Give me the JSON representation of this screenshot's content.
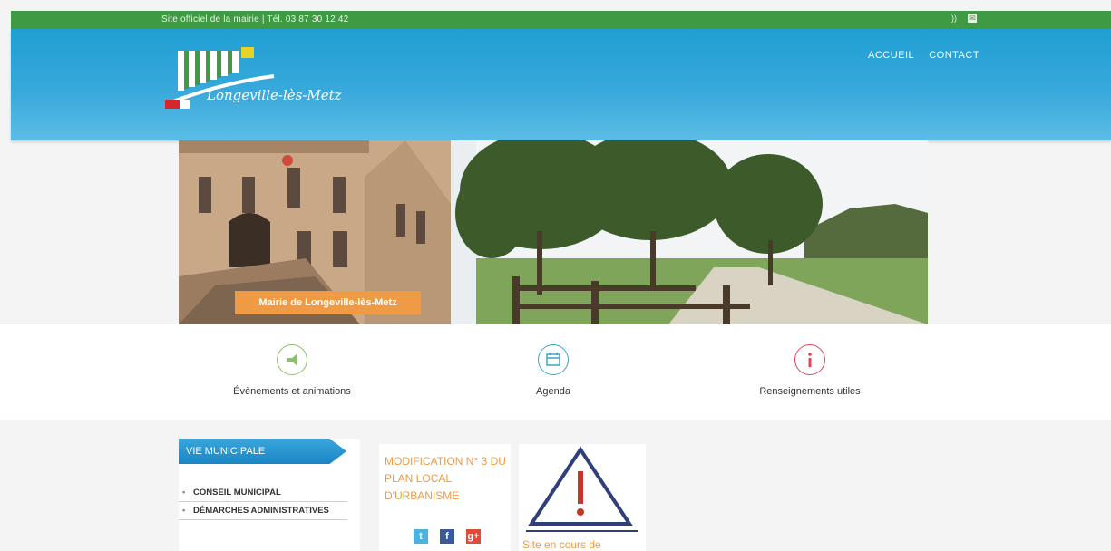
{
  "topbar": {
    "tagline": "Site officiel de la mairie | Tél. 03 87 30 12 42",
    "icons": [
      "rss-icon",
      "mail-icon"
    ]
  },
  "header": {
    "logo_text": "Longeville-lès-Metz",
    "nav": [
      {
        "label": "ACCUEIL"
      },
      {
        "label": "CONTACT"
      }
    ]
  },
  "banner": {
    "caption": "Mairie de Longeville-lès-Metz"
  },
  "quicklinks": [
    {
      "label": "Évènements et animations",
      "icon": "megaphone-icon",
      "color": "#8cc06a"
    },
    {
      "label": "Agenda",
      "icon": "calendar-icon",
      "color": "#3aa8c8"
    },
    {
      "label": "Renseignements utiles",
      "icon": "info-icon",
      "color": "#e0455a"
    }
  ],
  "sidebar": {
    "heading": "VIE MUNICIPALE",
    "items": [
      {
        "label": "CONSEIL MUNICIPAL"
      },
      {
        "label": "DÉMARCHES ADMINISTRATIVES"
      }
    ]
  },
  "news": [
    {
      "title": "MODIFICATION N° 3 DU PLAN LOCAL D'URBANISME"
    },
    {
      "title": "Site en cours de"
    }
  ],
  "social": [
    {
      "name": "twitter-icon",
      "glyph": "t",
      "color": "#4ab3e0"
    },
    {
      "name": "facebook-icon",
      "glyph": "f",
      "color": "#3b5a9a"
    },
    {
      "name": "googleplus-icon",
      "glyph": "g+",
      "color": "#dd4b39"
    }
  ],
  "colors": {
    "topbar": "#3e9a43",
    "header": "#2aa3d8",
    "accent_orange": "#ef9a45"
  }
}
